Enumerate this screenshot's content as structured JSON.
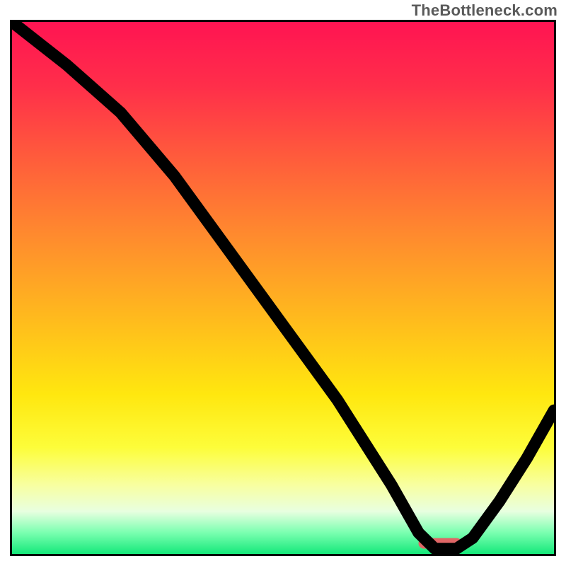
{
  "watermark": "TheBottleneck.com",
  "chart_data": {
    "type": "line",
    "title": "",
    "xlabel": "",
    "ylabel": "",
    "xlim": [
      0,
      100
    ],
    "ylim": [
      0,
      100
    ],
    "grid": false,
    "legend": false,
    "series": [
      {
        "name": "bottleneck-curve",
        "x": [
          0,
          10,
          20,
          25,
          30,
          40,
          50,
          60,
          70,
          75,
          78,
          82,
          85,
          90,
          95,
          100
        ],
        "values": [
          100,
          92,
          83,
          77,
          71,
          57,
          43,
          29,
          13,
          4,
          1,
          1,
          3,
          10,
          18,
          27
        ]
      }
    ],
    "marker": {
      "name": "target-segment",
      "x_start": 75,
      "x_end": 83,
      "y": 2
    },
    "background_gradient": {
      "stops": [
        {
          "offset": 0.0,
          "color": "#ff1452"
        },
        {
          "offset": 0.12,
          "color": "#ff2e4a"
        },
        {
          "offset": 0.25,
          "color": "#ff5a3c"
        },
        {
          "offset": 0.4,
          "color": "#ff8a2e"
        },
        {
          "offset": 0.55,
          "color": "#ffb81e"
        },
        {
          "offset": 0.7,
          "color": "#ffe70f"
        },
        {
          "offset": 0.8,
          "color": "#fdfd3a"
        },
        {
          "offset": 0.87,
          "color": "#f8ffa0"
        },
        {
          "offset": 0.92,
          "color": "#e8ffe0"
        },
        {
          "offset": 0.96,
          "color": "#7affb0"
        },
        {
          "offset": 1.0,
          "color": "#15e87a"
        }
      ]
    }
  }
}
